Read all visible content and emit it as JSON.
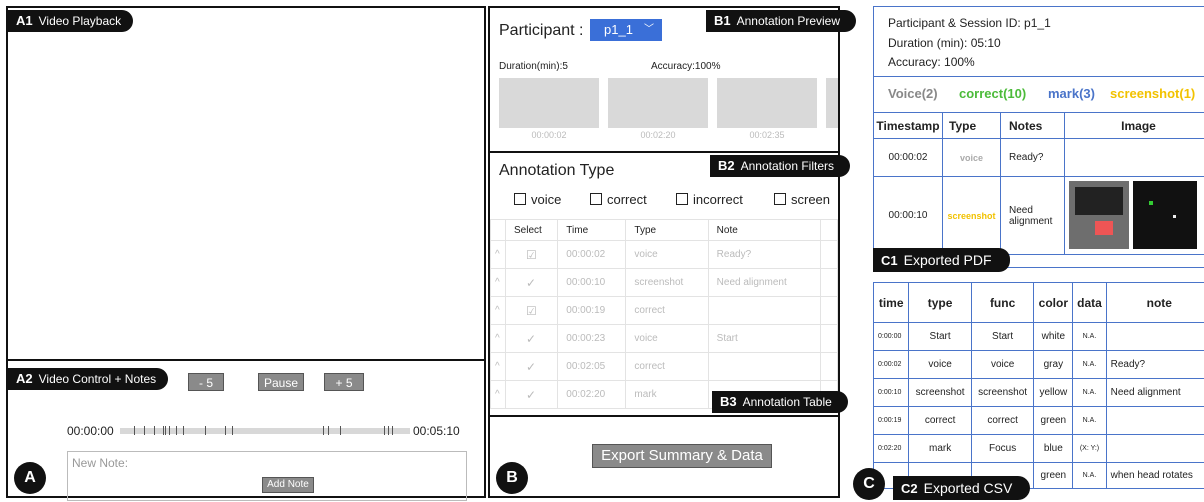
{
  "panel_a": {
    "circle": "A",
    "video_tag_id": "A1",
    "video_tag": "Video Playback",
    "control_tag_id": "A2",
    "control_tag": "Video Control + Notes",
    "minus_btn": "- 5",
    "pause_btn": "Pause",
    "plus_btn": "+ 5",
    "time_start": "00:00:00",
    "time_end": "00:05:10",
    "note_placeholder": "New Note:",
    "add_note_btn": "Add Note"
  },
  "panel_b": {
    "circle": "B",
    "preview_tag_id": "B1",
    "preview_tag": "Annotation Preview",
    "participant_label": "Participant :",
    "participant_value": "p1_1",
    "duration": "Duration(min):5",
    "accuracy": "Accuracy:100%",
    "thumbs": [
      "00:00:02",
      "00:02:20",
      "00:02:35"
    ],
    "filters_tag_id": "B2",
    "filters_tag": "Annotation Filters",
    "annotation_type_title": "Annotation Type",
    "filters": [
      "voice",
      "correct",
      "incorrect",
      "screen"
    ],
    "table_tag_id": "B3",
    "table_tag": "Annotation Table",
    "headers": [
      "Select",
      "Time",
      "Type",
      "Note"
    ],
    "rows": [
      {
        "check": "☑",
        "time": "00:00:02",
        "type": "voice",
        "note": "Ready?"
      },
      {
        "check": "✓",
        "time": "00:00:10",
        "type": "screenshot",
        "note": "Need alignment"
      },
      {
        "check": "☑",
        "time": "00:00:19",
        "type": "correct",
        "note": ""
      },
      {
        "check": "✓",
        "time": "00:00:23",
        "type": "voice",
        "note": "Start"
      },
      {
        "check": "✓",
        "time": "00:02:05",
        "type": "correct",
        "note": ""
      },
      {
        "check": "✓",
        "time": "00:02:20",
        "type": "mark",
        "note": ""
      }
    ],
    "export_btn": "Export Summary & Data"
  },
  "panel_c": {
    "circle": "C",
    "pdf_line1": "Participant & Session ID: p1_1",
    "pdf_line2": "Duration (min): 05:10",
    "pdf_line3": "Accuracy: 100%",
    "counts": [
      {
        "label": "Voice(2)",
        "color": "#888888"
      },
      {
        "label": "correct(10)",
        "color": "#4cbb3a"
      },
      {
        "label": "mark(3)",
        "color": "#4a74c9"
      },
      {
        "label": "screenshot(1)",
        "color": "#f2c200"
      }
    ],
    "pdf_headers": [
      "Timestamp",
      "Type",
      "Notes",
      "Image"
    ],
    "pdf_rows": [
      {
        "time": "00:00:02",
        "type": "voice",
        "type_color": "#aaaaaa",
        "note": "Ready?"
      },
      {
        "time": "00:00:10",
        "type": "screenshot",
        "type_color": "#f2c200",
        "note": "Need alignment"
      }
    ],
    "pdf_tag_id": "C1",
    "pdf_tag": "Exported PDF",
    "csv_headers": [
      "time",
      "type",
      "func",
      "color",
      "data",
      "note"
    ],
    "csv_rows": [
      [
        "0:00:00",
        "Start",
        "Start",
        "white",
        "N.A.",
        ""
      ],
      [
        "0:00:02",
        "voice",
        "voice",
        "gray",
        "N.A.",
        "Ready?"
      ],
      [
        "0:00:10",
        "screenshot",
        "screenshot",
        "yellow",
        "N.A.",
        "Need alignment"
      ],
      [
        "0:00:19",
        "correct",
        "correct",
        "green",
        "N.A.",
        ""
      ],
      [
        "0:02:20",
        "mark",
        "Focus",
        "blue",
        "(X: Y:)",
        ""
      ],
      [
        "",
        "",
        "",
        "green",
        "N.A.",
        "when head rotates"
      ]
    ],
    "csv_tag_id": "C2",
    "csv_tag": "Exported CSV"
  }
}
